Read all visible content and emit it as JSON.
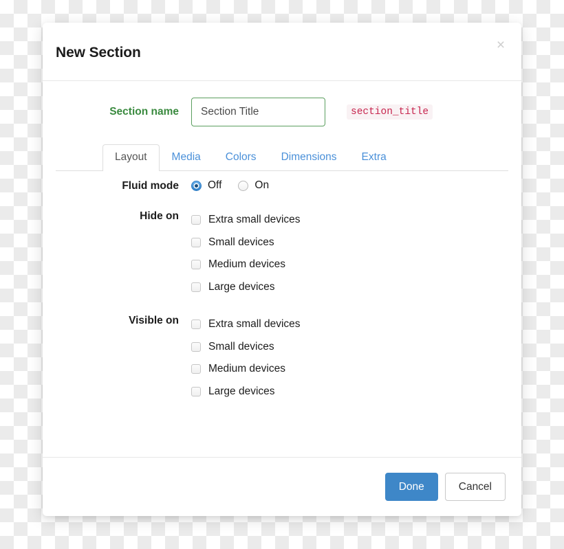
{
  "modal": {
    "title": "New Section",
    "close_icon": "close-icon",
    "close_label": "×"
  },
  "section_name": {
    "label": "Section name",
    "input_value": "Section Title",
    "input_placeholder": "Section Title",
    "code_badge": "section_title",
    "label_color": "#3a8a3f",
    "input_border_color": "#5a9e5e",
    "badge_text_color": "#c7254e",
    "badge_bg_color": "#f9f2f4"
  },
  "tabs": {
    "active": "Layout",
    "items": [
      {
        "label": "Layout",
        "active": true
      },
      {
        "label": "Media",
        "active": false
      },
      {
        "label": "Colors",
        "active": false
      },
      {
        "label": "Dimensions",
        "active": false
      },
      {
        "label": "Extra",
        "active": false
      }
    ],
    "link_color": "#4a90d9",
    "active_color": "#555555"
  },
  "fluid_mode": {
    "label": "Fluid mode",
    "options": [
      {
        "label": "Off",
        "checked": true
      },
      {
        "label": "On",
        "checked": false
      }
    ]
  },
  "hide_on": {
    "label": "Hide on",
    "options": [
      {
        "label": "Extra small devices",
        "checked": false
      },
      {
        "label": "Small devices",
        "checked": false
      },
      {
        "label": "Medium devices",
        "checked": false
      },
      {
        "label": "Large devices",
        "checked": false
      }
    ]
  },
  "visible_on": {
    "label": "Visible on",
    "options": [
      {
        "label": "Extra small devices",
        "checked": false
      },
      {
        "label": "Small devices",
        "checked": false
      },
      {
        "label": "Medium devices",
        "checked": false
      },
      {
        "label": "Large devices",
        "checked": false
      }
    ]
  },
  "footer": {
    "done_label": "Done",
    "cancel_label": "Cancel",
    "primary_color": "#3e87c8"
  }
}
